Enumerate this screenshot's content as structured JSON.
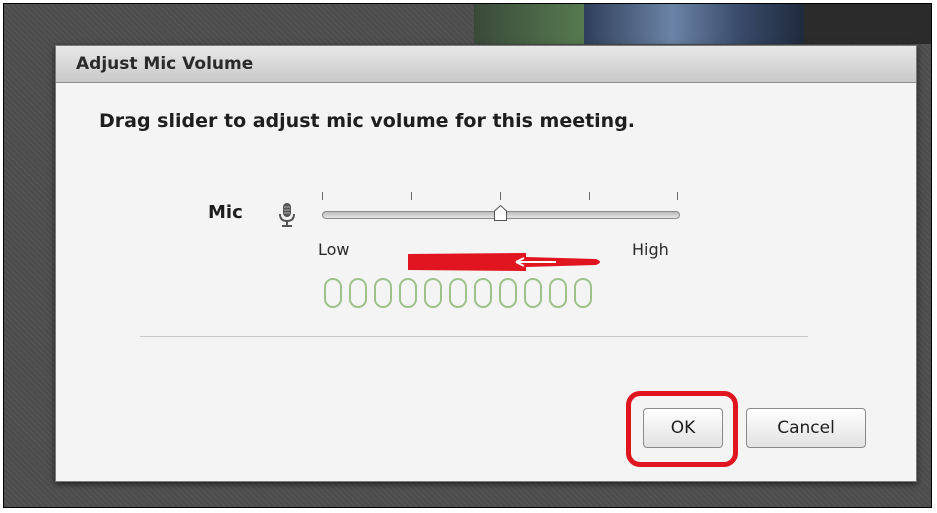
{
  "dialog": {
    "title": "Adjust Mic Volume",
    "instruction": "Drag slider to adjust mic volume for this meeting.",
    "mic_label": "Mic",
    "slider": {
      "low_label": "Low",
      "high_label": "High",
      "value": 0.5,
      "tick_count": 5
    },
    "meter": {
      "segment_count": 11,
      "active_segments": 0,
      "segment_color": "#9ec28a"
    },
    "buttons": {
      "ok_label": "OK",
      "cancel_label": "Cancel"
    }
  },
  "annotations": {
    "arrow_color": "#e1151f",
    "highlight_color": "#e1151f"
  },
  "icons": {
    "mic": "microphone-icon",
    "arrow": "left-arrow-annotation",
    "thumb": "slider-thumb"
  }
}
